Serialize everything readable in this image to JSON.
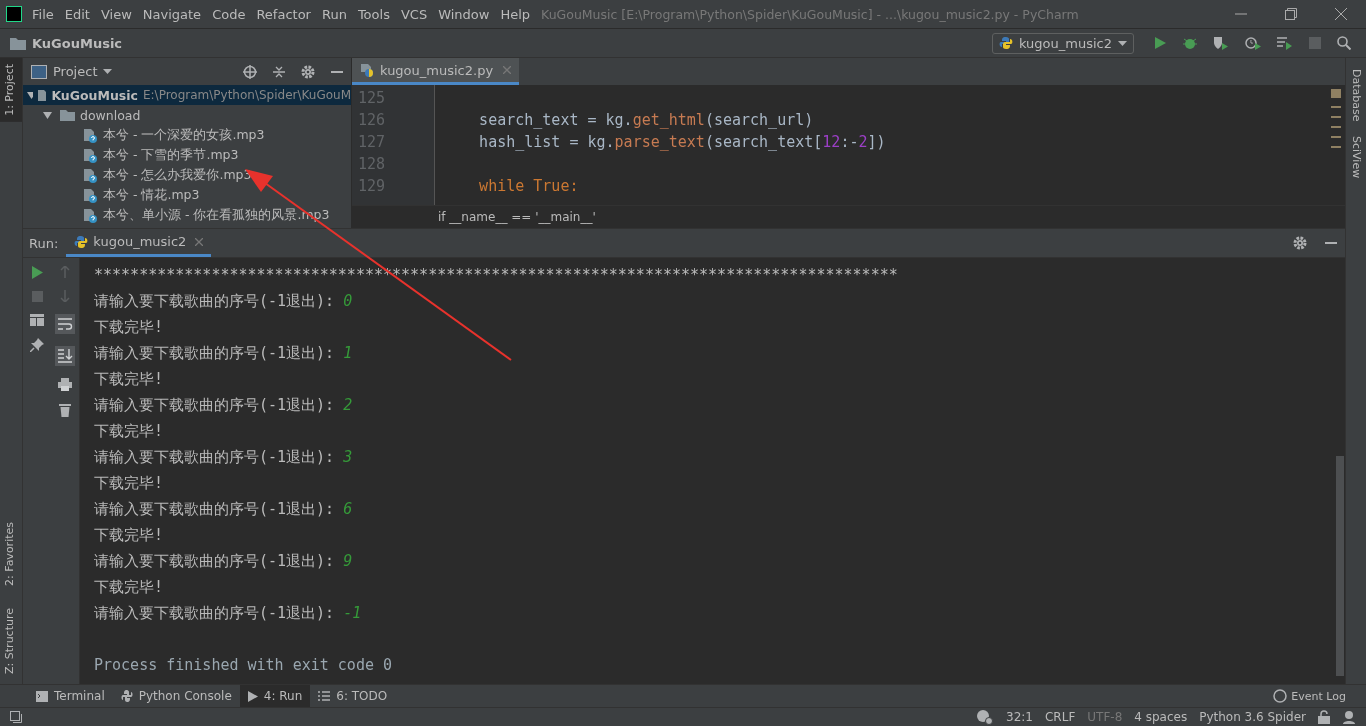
{
  "window": {
    "title": "KuGouMusic [E:\\Program\\Python\\Spider\\KuGouMusic] - ...\\kugou_music2.py - PyCharm"
  },
  "menu": [
    "File",
    "Edit",
    "View",
    "Navigate",
    "Code",
    "Refactor",
    "Run",
    "Tools",
    "VCS",
    "Window",
    "Help"
  ],
  "navbar": {
    "project": "KuGouMusic",
    "run_config": "kugou_music2"
  },
  "left_strip": [
    {
      "label": "1: Project",
      "selected": true
    },
    {
      "label": "2: Favorites",
      "selected": false
    },
    {
      "label": "Z: Structure",
      "selected": false
    }
  ],
  "right_strip": [
    "Database",
    "SciView"
  ],
  "project_panel": {
    "title": "Project",
    "tree": [
      {
        "name": "KuGouMusic",
        "path": "E:\\Program\\Python\\Spider\\KuGouM",
        "expanded": true,
        "selected": true,
        "children": [
          {
            "name": "download",
            "expanded": true,
            "selected": false,
            "children": [
              {
                "name": "本兮 - 一个深爱的女孩.mp3",
                "selected": false
              },
              {
                "name": "本兮 - 下雪的季节.mp3",
                "selected": false
              },
              {
                "name": "本兮 - 怎么办我爱你.mp3",
                "selected": false
              },
              {
                "name": "本兮 - 情花.mp3",
                "selected": false
              },
              {
                "name": "本兮、单小源 - 你在看孤独的风景.mp3",
                "selected": false
              }
            ]
          }
        ]
      }
    ]
  },
  "editor": {
    "tab": "kugou_music2.py",
    "lines": [
      {
        "number": "125"
      },
      {
        "number": "126",
        "tokens": [
          {
            "kind": "plain",
            "text": "    search_text = kg."
          },
          {
            "kind": "call",
            "text": "get_html"
          },
          {
            "kind": "plain",
            "text": "(search_url)"
          }
        ]
      },
      {
        "number": "127",
        "tokens": [
          {
            "kind": "plain",
            "text": "    hash_list = kg."
          },
          {
            "kind": "call",
            "text": "parse_text"
          },
          {
            "kind": "plain",
            "text": "(search_text["
          },
          {
            "kind": "number",
            "text": "12"
          },
          {
            "kind": "plain",
            "text": ":-"
          },
          {
            "kind": "number",
            "text": "2"
          },
          {
            "kind": "plain",
            "text": "])"
          }
        ]
      },
      {
        "number": "128"
      },
      {
        "number": "129",
        "tokens": [
          {
            "kind": "keyword",
            "text": "    while True:"
          }
        ]
      }
    ],
    "breadcrumb": "if __name__ == '__main__'"
  },
  "run_panel": {
    "label": "Run:",
    "tab": "kugou_music2",
    "console": [
      {
        "kind": "stars",
        "text": "*****************************************************************************************"
      },
      {
        "kind": "prompt",
        "text": "请输入要下载歌曲的序号(-1退出): ",
        "input": "0"
      },
      {
        "kind": "output",
        "text": "下载完毕!"
      },
      {
        "kind": "prompt",
        "text": "请输入要下载歌曲的序号(-1退出): ",
        "input": "1"
      },
      {
        "kind": "output",
        "text": "下载完毕!"
      },
      {
        "kind": "prompt",
        "text": "请输入要下载歌曲的序号(-1退出): ",
        "input": "2"
      },
      {
        "kind": "output",
        "text": "下载完毕!"
      },
      {
        "kind": "prompt",
        "text": "请输入要下载歌曲的序号(-1退出): ",
        "input": "3"
      },
      {
        "kind": "output",
        "text": "下载完毕!"
      },
      {
        "kind": "prompt",
        "text": "请输入要下载歌曲的序号(-1退出): ",
        "input": "6"
      },
      {
        "kind": "output",
        "text": "下载完毕!"
      },
      {
        "kind": "prompt",
        "text": "请输入要下载歌曲的序号(-1退出): ",
        "input": "9"
      },
      {
        "kind": "output",
        "text": "下载完毕!"
      },
      {
        "kind": "prompt",
        "text": "请输入要下载歌曲的序号(-1退出): ",
        "input": "-1"
      },
      {
        "kind": "blank"
      },
      {
        "kind": "exit",
        "text": "Process finished with exit code 0"
      }
    ]
  },
  "tool_tabs": [
    {
      "label": "Terminal",
      "selected": false
    },
    {
      "label": "Python Console",
      "selected": false
    },
    {
      "label": "4: Run",
      "selected": true
    },
    {
      "label": "6: TODO",
      "selected": false
    }
  ],
  "event_log": "Event Log",
  "status_bar": [
    "32:1",
    "CRLF",
    "UTF-8",
    "4 spaces",
    "Python 3.6 Spider"
  ]
}
